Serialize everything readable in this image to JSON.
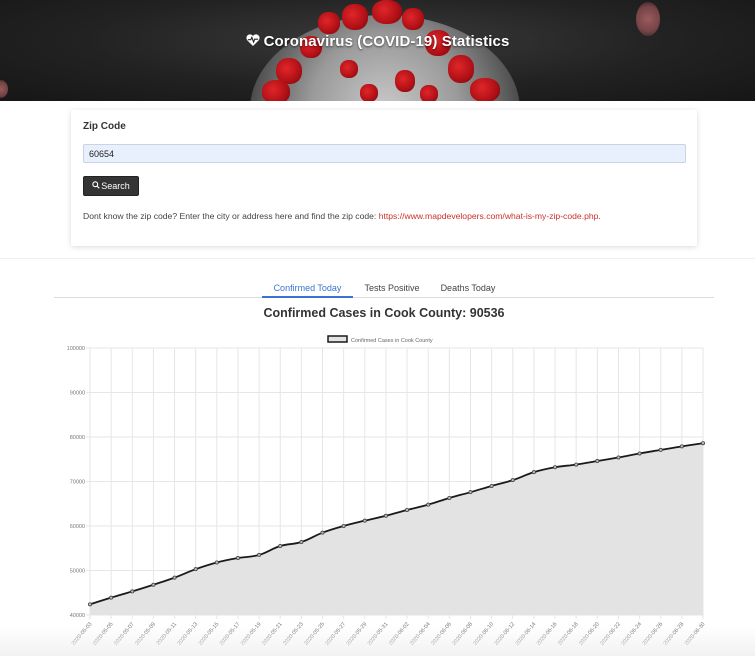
{
  "header": {
    "icon": "heartbeat-icon",
    "title": "Coronavirus (COVID-19) Statistics"
  },
  "search_card": {
    "label": "Zip Code",
    "zip_value": "60654",
    "zip_placeholder": "",
    "search_button_label": "Search",
    "search_button_icon": "search-icon",
    "help_text": "Dont know the zip code? Enter the city or address here and find the zip code: ",
    "help_link_text": "https://www.mapdevelopers.com/what-is-my-zip-code.php",
    "help_trailing": "."
  },
  "tabs": [
    {
      "label": "Confirmed Today",
      "active": true
    },
    {
      "label": "Tests Positive",
      "active": false
    },
    {
      "label": "Deaths Today",
      "active": false
    }
  ],
  "colors": {
    "accent": "#3b73d4",
    "link": "#c9302c",
    "line": "#1a1a1a",
    "fill": "#e3e3e3"
  },
  "chart_data": {
    "type": "area",
    "title": "Confirmed Cases in Cook County: 90536",
    "xlabel": "",
    "ylabel": "",
    "ylim": [
      40000,
      100000
    ],
    "yticks": [
      40000,
      50000,
      60000,
      70000,
      80000,
      90000,
      100000
    ],
    "grid": true,
    "legend": {
      "position": "top",
      "entries": [
        "Confirmed Cases in Cook County"
      ]
    },
    "categories": [
      "2020-05-03",
      "2020-05-05",
      "2020-05-07",
      "2020-05-09",
      "2020-05-11",
      "2020-05-13",
      "2020-05-15",
      "2020-05-17",
      "2020-05-19",
      "2020-05-21",
      "2020-05-23",
      "2020-05-25",
      "2020-05-27",
      "2020-05-29",
      "2020-05-31",
      "2020-06-02",
      "2020-06-04",
      "2020-06-06",
      "2020-06-08",
      "2020-06-10",
      "2020-06-12",
      "2020-06-14",
      "2020-06-16",
      "2020-06-18",
      "2020-06-20",
      "2020-06-22",
      "2020-06-24",
      "2020-06-26",
      "2020-06-28",
      "2020-06-30"
    ],
    "series": [
      {
        "name": "Confirmed Cases in Cook County",
        "values": [
          42400,
          43900,
          45300,
          46800,
          48400,
          50300,
          51800,
          52800,
          53500,
          55500,
          56400,
          58500,
          60000,
          61200,
          62300,
          63600,
          64800,
          66300,
          67600,
          69000,
          70300,
          72100,
          73200,
          73800,
          74600,
          75400,
          76300,
          77100,
          77900,
          78600
        ]
      }
    ]
  }
}
